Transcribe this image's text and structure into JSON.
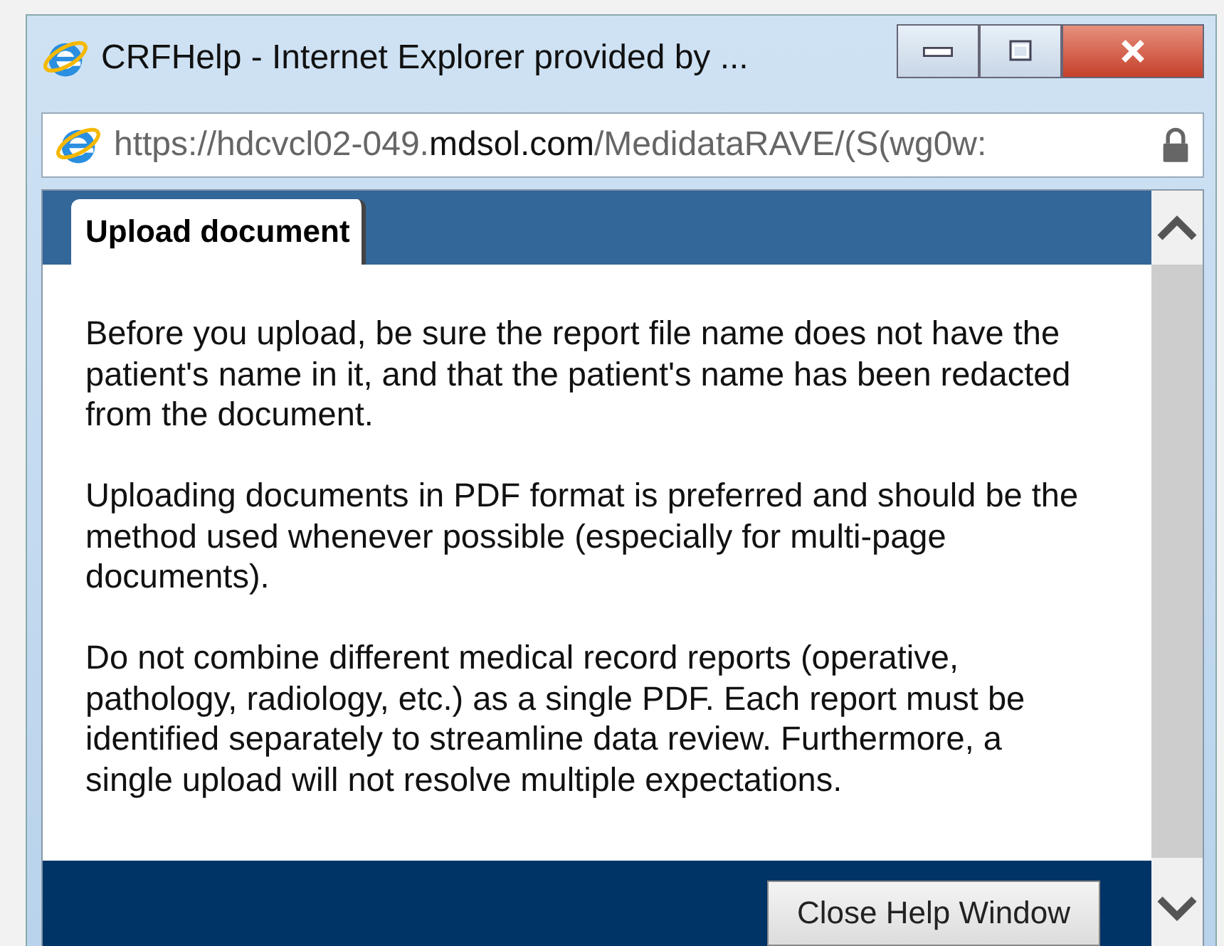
{
  "window": {
    "title": "CRFHelp - Internet Explorer provided by ..."
  },
  "address_bar": {
    "url_parts": [
      {
        "text": "https://",
        "emphasis": false
      },
      {
        "text": "hdcvcl02-049.",
        "emphasis": false
      },
      {
        "text": "mdsol.com",
        "emphasis": true
      },
      {
        "text": "/MedidataRAVE/(S(wg0w:",
        "emphasis": false
      }
    ],
    "secure": true
  },
  "tabs": [
    {
      "label": "Upload document",
      "selected": true
    }
  ],
  "paragraphs": [
    "Before you upload, be sure the report file name does not have the patient's name in it, and that the patient's name has been redacted from the document.",
    "Uploading documents in PDF format is preferred and should be the method used whenever possible (especially for multi-page documents).",
    "Do not combine different medical record reports (operative, pathology, radiology, etc.) as a single PDF. Each report must be identified separately to streamline data review. Furthermore, a single upload will not resolve multiple expectations."
  ],
  "buttons": [
    "Close Help Window"
  ]
}
